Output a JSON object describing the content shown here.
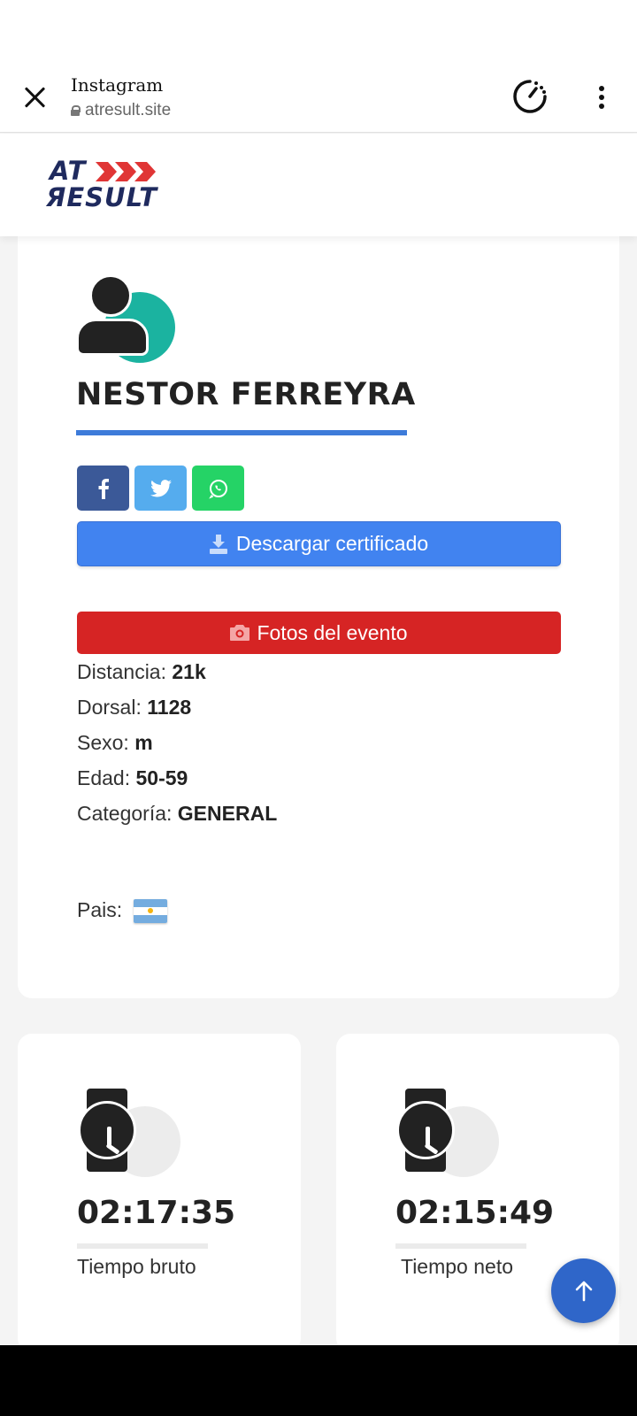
{
  "browser": {
    "title": "Instagram",
    "url": "atresult.site"
  },
  "site": {
    "logo_line1": "AT",
    "logo_line2": "ЯESULT",
    "brand_color": "#1f2a5e",
    "accent_color": "#e03535"
  },
  "profile": {
    "name": "NESTOR FERREYRA",
    "share": {
      "facebook_icon": "facebook-icon",
      "twitter_icon": "twitter-icon",
      "whatsapp_icon": "whatsapp-icon"
    },
    "cert_button": "Descargar certificado",
    "photos_button": "Fotos del evento",
    "details": [
      {
        "label": "Distancia: ",
        "value": "21k"
      },
      {
        "label": "Dorsal: ",
        "value": "1128"
      },
      {
        "label": "Sexo: ",
        "value": "m"
      },
      {
        "label": "Edad: ",
        "value": "50-59"
      },
      {
        "label": "Categoría: ",
        "value": "GENERAL"
      }
    ],
    "country_label": "Pais:",
    "country_flag": "argentina-flag"
  },
  "times": [
    {
      "value": "02:17:35",
      "label": "Tiempo bruto"
    },
    {
      "value": "02:15:49",
      "label": "Tiempo neto"
    }
  ],
  "colors": {
    "cert_button": "#4183f0",
    "photos_button": "#d62424",
    "facebook": "#3b5998",
    "twitter": "#55acee",
    "whatsapp": "#25d366",
    "underline": "#3d7bd9",
    "avatar_accent": "#1bb3a0",
    "fab": "#2f66c9"
  }
}
